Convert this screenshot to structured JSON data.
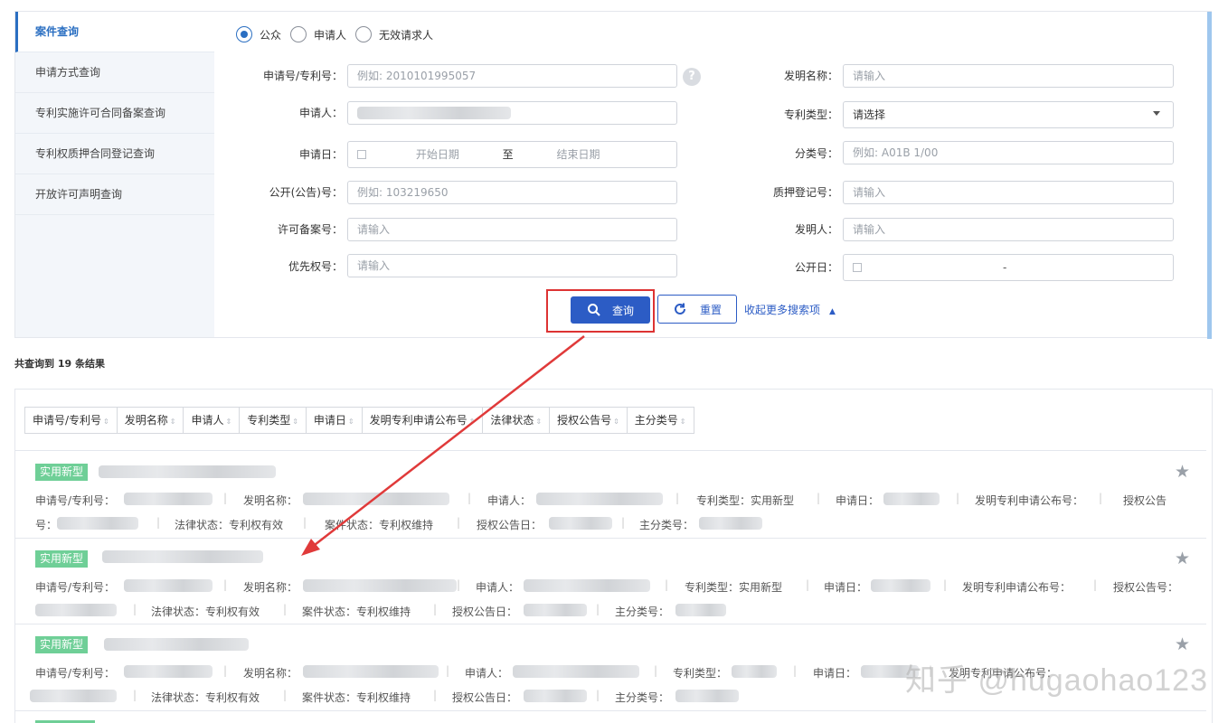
{
  "sidebar": {
    "items": [
      {
        "label": "案件查询"
      },
      {
        "label": "申请方式查询"
      },
      {
        "label": "专利实施许可合同备案查询"
      },
      {
        "label": "专利权质押合同登记查询"
      },
      {
        "label": "开放许可声明查询"
      }
    ]
  },
  "radios": [
    {
      "label": "公众"
    },
    {
      "label": "申请人"
    },
    {
      "label": "无效请求人"
    }
  ],
  "form": {
    "app_no": {
      "label": "申请号/专利号：",
      "placeholder": "例如: 2010101995057"
    },
    "invention_name": {
      "label": "发明名称：",
      "placeholder": "请输入"
    },
    "applicant": {
      "label": "申请人："
    },
    "patent_type": {
      "label": "专利类型：",
      "value": "请选择"
    },
    "app_date": {
      "label": "申请日：",
      "start": "开始日期",
      "to": "至",
      "end": "结束日期"
    },
    "class_no": {
      "label": "分类号：",
      "placeholder": "例如: A01B 1/00"
    },
    "pub_no": {
      "label": "公开(公告)号：",
      "placeholder": "例如: 103219650"
    },
    "pledge_no": {
      "label": "质押登记号：",
      "placeholder": "请输入"
    },
    "license_no": {
      "label": "许可备案号：",
      "placeholder": "请输入"
    },
    "inventor": {
      "label": "发明人：",
      "placeholder": "请输入"
    },
    "priority": {
      "label": "优先权号：",
      "placeholder": "请输入"
    },
    "pub_date": {
      "label": "公开日：",
      "dash": "-"
    }
  },
  "actions": {
    "query": "查询",
    "reset": "重置",
    "collapse": "收起更多搜索项"
  },
  "result_count": {
    "prefix": "共查询到",
    "count": "19",
    "suffix": "条结果"
  },
  "sort_headers": [
    "申请号/专利号",
    "发明名称",
    "申请人",
    "专利类型",
    "申请日",
    "发明专利申请公布号",
    "法律状态",
    "授权公告号",
    "主分类号"
  ],
  "results": [
    {
      "tag": "实用新型",
      "f_app": "申请号/专利号：",
      "f_name": "发明名称：",
      "f_applicant": "申请人：",
      "f_type": "专利类型：实用新型",
      "f_date": "申请日：",
      "f_pubapp": "发明专利申请公布号：",
      "f_grant": "授权公告",
      "f_grant2": "号：",
      "f_legal": "法律状态：专利权有效",
      "f_case": "案件状态：专利权维持",
      "f_grantdate": "授权公告日：",
      "f_class": "主分类号："
    },
    {
      "tag": "实用新型",
      "f_app": "申请号/专利号：",
      "f_name": "发明名称：",
      "f_applicant": "申请人：",
      "f_type": "专利类型：实用新型",
      "f_date": "申请日：",
      "f_pubapp": "发明专利申请公布号：",
      "f_grant": "授权公告号：",
      "f_legal": "法律状态：专利权有效",
      "f_case": "案件状态：专利权维持",
      "f_grantdate": "授权公告日：",
      "f_class": "主分类号："
    },
    {
      "tag": "实用新型",
      "f_app": "申请号/专利号：",
      "f_name": "发明名称：",
      "f_applicant": "申请人：",
      "f_type": "专利类型：",
      "f_date": "申请日：",
      "f_pubapp": "发明专利申请公布号：",
      "f_legal": "法律状态：专利权有效",
      "f_case": "案件状态：专利权维持",
      "f_grantdate": "授权公告日：",
      "f_class": "主分类号："
    }
  ],
  "watermark": "知乎 @hugaohao123",
  "colors": {
    "accent": "#2c5cc5",
    "tag": "#6fcf97",
    "highlight": "#dd3333"
  }
}
